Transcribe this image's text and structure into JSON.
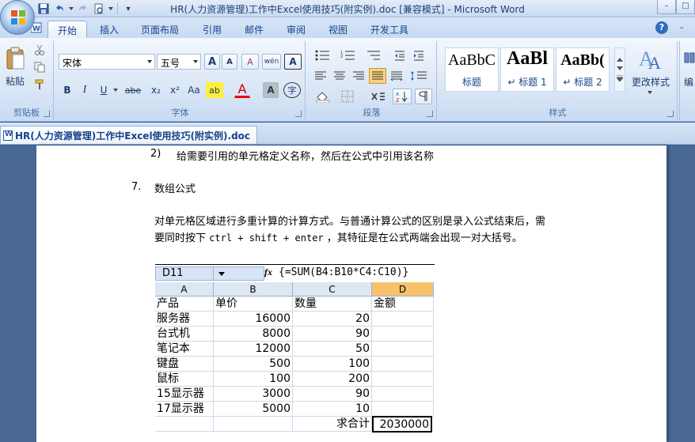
{
  "window": {
    "title": "HR(人力资源管理)工作中Excel使用技巧(附实例).doc [兼容模式] - Microsoft Word",
    "min_label": "–",
    "max_label": "□"
  },
  "qat": {
    "customize_label": "▾"
  },
  "tabs": [
    "开始",
    "插入",
    "页面布局",
    "引用",
    "邮件",
    "审阅",
    "视图",
    "开发工具"
  ],
  "ribbon": {
    "clipboard": {
      "paste_label": "粘贴",
      "group_label": "剪贴板"
    },
    "font": {
      "font_name": "宋体",
      "font_size": "五号",
      "grow_label": "A",
      "shrink_label": "A",
      "clear_label": "A",
      "phonetic_label": "wén",
      "border_char_label": "A",
      "bold_label": "B",
      "italic_label": "I",
      "underline_label": "U",
      "strike_label": "abe",
      "sub_label": "x₂",
      "sup_label": "x²",
      "case_label": "Aa",
      "highlight_label": "ab",
      "color_label": "A",
      "shade_label": "A",
      "enclose_label": "字",
      "group_label": "字体"
    },
    "paragraph": {
      "group_label": "段落"
    },
    "styles": {
      "items": [
        {
          "sample": "AaBbC",
          "name": "标题"
        },
        {
          "sample": "AaBl",
          "name": "↵ 标题 1"
        },
        {
          "sample": "AaBb(",
          "name": "↵ 标题 2"
        }
      ],
      "change_label": "更改样式",
      "group_label": "样式"
    },
    "editing": {
      "label": "编"
    }
  },
  "help_label": "?",
  "document_tab": "HR(人力资源管理)工作中Excel使用技巧(附实例).doc",
  "doc": {
    "line1_num": "2)",
    "line1_text": "给需要引用的单元格定义名称，然后在公式中引用该名称",
    "section_num": "7.",
    "section_title": "数组公式",
    "para_line1": "对单元格区域进行多重计算的计算方式。与普通计算公式的区别是录入公式结束后，需",
    "para_line2_a": "要同时按下",
    "para_line2_keys": "ctrl + shift + enter",
    "para_line2_b": "，其特征是在公式两端会出现一对大括号。"
  },
  "excel": {
    "name_box": "D11",
    "fx": "fx",
    "formula": "{=SUM(B4:B10*C4:C10)}",
    "columns": [
      "A",
      "B",
      "C",
      "D"
    ],
    "rows": [
      [
        "产品",
        "单价",
        "数量",
        "金额"
      ],
      [
        "服务器",
        "16000",
        "20",
        ""
      ],
      [
        "台式机",
        "8000",
        "90",
        ""
      ],
      [
        "笔记本",
        "12000",
        "50",
        ""
      ],
      [
        "键盘",
        "500",
        "100",
        ""
      ],
      [
        "鼠标",
        "100",
        "200",
        ""
      ],
      [
        "15显示器",
        "3000",
        "90",
        ""
      ],
      [
        "17显示器",
        "5000",
        "10",
        ""
      ],
      [
        "",
        "",
        "求合计",
        "2030000"
      ]
    ]
  },
  "colors": {
    "ribbon_bg": "#dbe7f6",
    "text_blue": "#15428b",
    "workspace": "#4a6894",
    "selected_col": "#f7c26a"
  }
}
